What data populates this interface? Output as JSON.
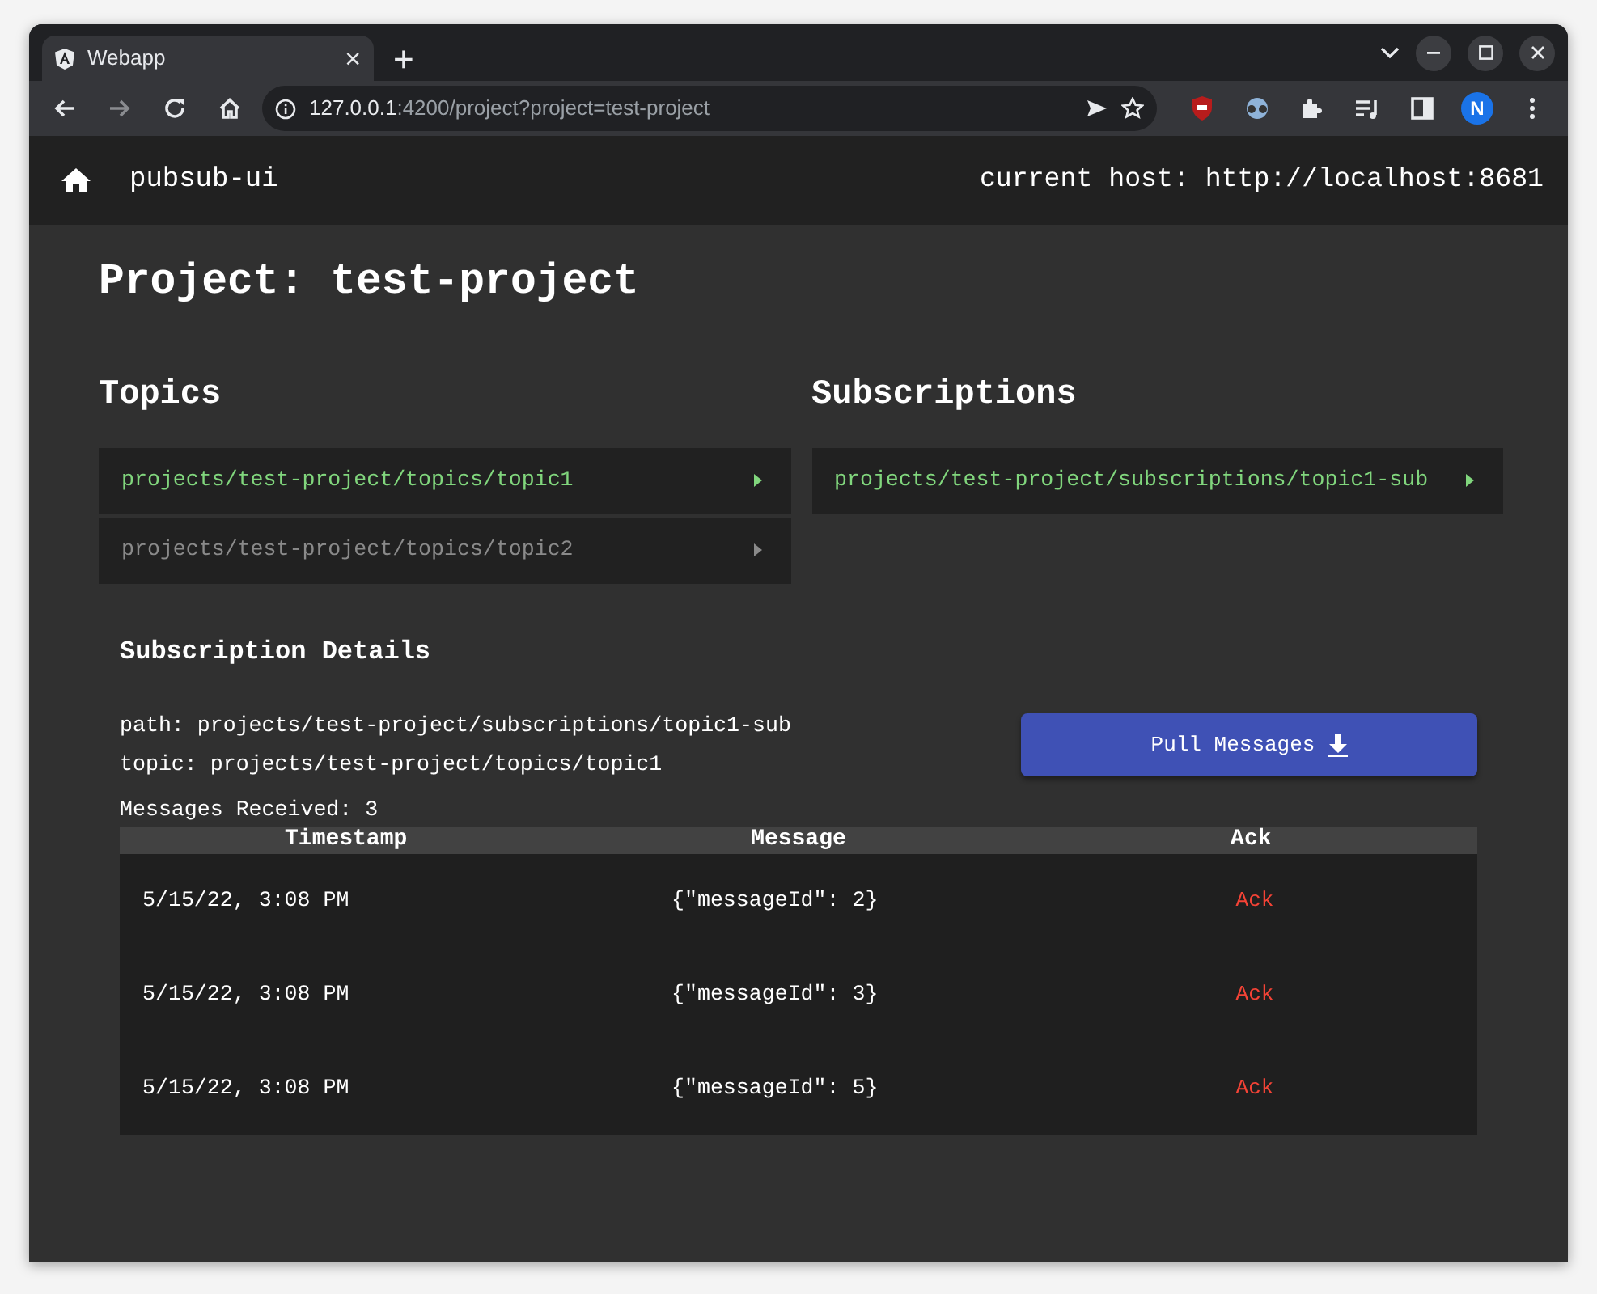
{
  "browser": {
    "tab": {
      "title": "Webapp",
      "close": "×"
    },
    "new_tab": "+",
    "address": {
      "host": "127.0.0.1",
      "rest": ":4200/project?project=test-project"
    },
    "profile_initial": "N"
  },
  "navbar": {
    "title": "pubsub-ui",
    "host": "current host: http://localhost:8681"
  },
  "heading": "Project: test-project",
  "topics": {
    "title": "Topics",
    "items": [
      {
        "label": "projects/test-project/topics/topic1",
        "selected": true
      },
      {
        "label": "projects/test-project/topics/topic2",
        "selected": false
      }
    ]
  },
  "subscriptions": {
    "title": "Subscriptions",
    "items": [
      {
        "label": "projects/test-project/subscriptions/topic1-sub",
        "selected": true
      }
    ]
  },
  "details": {
    "title": "Subscription Details",
    "path": "path: projects/test-project/subscriptions/topic1-sub",
    "topic": "topic: projects/test-project/topics/topic1",
    "pull_button": "Pull Messages",
    "count": "Messages Received: 3",
    "table": {
      "columns": [
        "Timestamp",
        "Message",
        "Ack"
      ],
      "rows": [
        {
          "timestamp": "5/15/22, 3:08 PM",
          "message": "{\"messageId\": 2}",
          "action": "Ack"
        },
        {
          "timestamp": "5/15/22, 3:08 PM",
          "message": "{\"messageId\": 3}",
          "action": "Ack"
        },
        {
          "timestamp": "5/15/22, 3:08 PM",
          "message": "{\"messageId\": 5}",
          "action": "Ack"
        }
      ]
    }
  }
}
